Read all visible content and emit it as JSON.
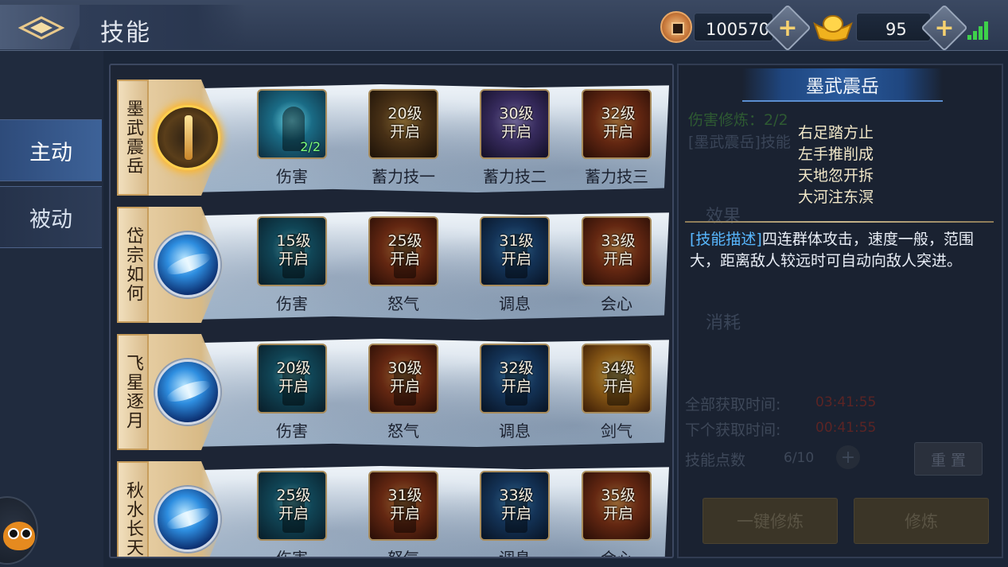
{
  "header": {
    "title": "技能",
    "copper": "100570",
    "gold": "95"
  },
  "tabs": {
    "active": "主动",
    "passive": "被动"
  },
  "skills": [
    {
      "name": "墨武震岳",
      "slots": [
        {
          "lock": "",
          "level": "2/2",
          "label": "伤害"
        },
        {
          "lock": "20级\n开启",
          "label": "蓄力技一"
        },
        {
          "lock": "30级\n开启",
          "label": "蓄力技二"
        },
        {
          "lock": "32级\n开启",
          "label": "蓄力技三"
        }
      ]
    },
    {
      "name": "岱宗如何",
      "slots": [
        {
          "lock": "15级\n开启",
          "label": "伤害"
        },
        {
          "lock": "25级\n开启",
          "label": "怒气"
        },
        {
          "lock": "31级\n开启",
          "label": "调息"
        },
        {
          "lock": "33级\n开启",
          "label": "会心"
        }
      ]
    },
    {
      "name": "飞星逐月",
      "slots": [
        {
          "lock": "20级\n开启",
          "label": "伤害"
        },
        {
          "lock": "30级\n开启",
          "label": "怒气"
        },
        {
          "lock": "32级\n开启",
          "label": "调息"
        },
        {
          "lock": "34级\n开启",
          "label": "剑气"
        }
      ]
    },
    {
      "name": "秋水长天",
      "slots": [
        {
          "lock": "25级\n开启",
          "label": "伤害"
        },
        {
          "lock": "31级\n开启",
          "label": "怒气"
        },
        {
          "lock": "33级\n开启",
          "label": "调息"
        },
        {
          "lock": "35级\n开启",
          "label": "会心"
        }
      ]
    }
  ],
  "detail": {
    "title": "墨武震岳",
    "faded_line1": "伤害修炼：2/2",
    "faded_line2": "[墨武震岳]技能",
    "poem": [
      "右足踏方止",
      "左手推削成",
      "天地忽开拆",
      "大河注东溟"
    ],
    "effect_head": "效果",
    "desc_tag": "[技能描述]",
    "desc_text": "四连群体攻击，速度一般，范围大，距离敌人较远时可自动向敌人突进。",
    "cost_head": "消耗",
    "total_time_label": "全部获取时间:",
    "total_time_value": "03:41:55",
    "next_time_label": "下个获取时间:",
    "next_time_value": "00:41:55",
    "points_label": "技能点数",
    "points_value": "6/10",
    "reset_label": "重 置",
    "train_all_label": "一键修炼",
    "train_label": "修炼"
  }
}
